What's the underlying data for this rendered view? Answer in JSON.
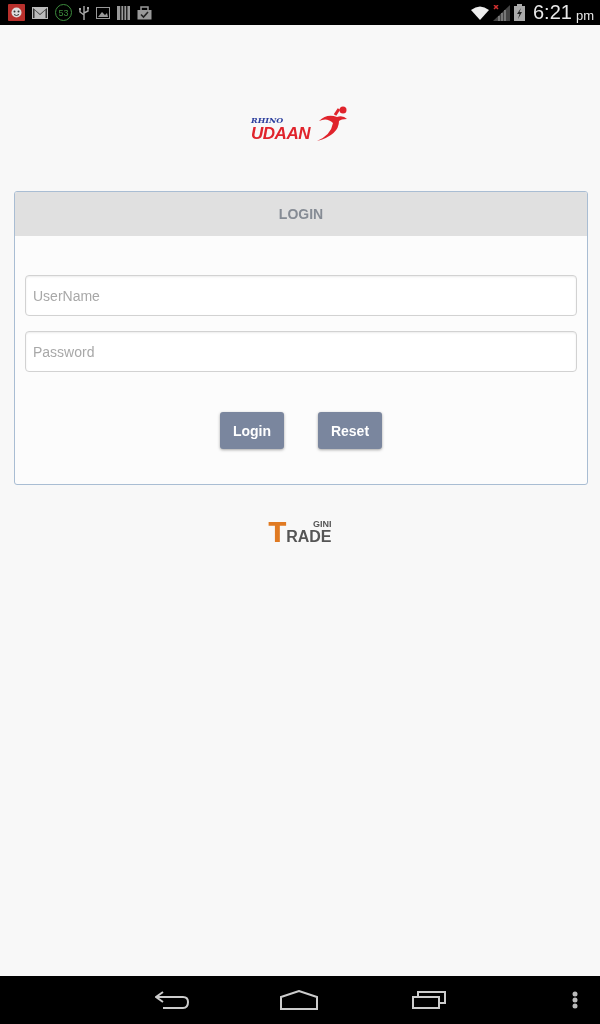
{
  "status_bar": {
    "notification_count": "53",
    "time": "6:21",
    "period": "pm"
  },
  "header_logo": {
    "script": "RHINO",
    "word": "UDAAN"
  },
  "login_card": {
    "title": "LOGIN",
    "fields": [
      {
        "placeholder": "UserName"
      },
      {
        "placeholder": "Password"
      }
    ],
    "buttons": [
      "Login",
      "Reset"
    ]
  },
  "footer_logo": {
    "top": "GINI",
    "initial": "T",
    "rest": "RADE"
  }
}
